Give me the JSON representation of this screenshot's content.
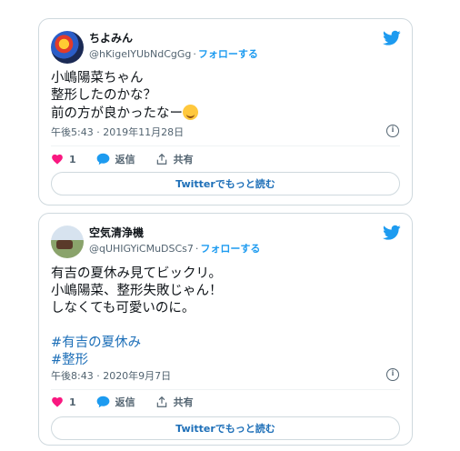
{
  "tweets": [
    {
      "name": "ちよみん",
      "handle": "@hKigeIYUbNdCgGg",
      "follow": "フォローする",
      "lines": [
        "小嶋陽菜ちゃん",
        "整形したのかな？",
        "前の方が良かったなー"
      ],
      "emoji": "relieved-face-emoji",
      "date": "午後5:43 · 2019年11月28日",
      "likes": "1",
      "reply_label": "返信",
      "share_label": "共有",
      "more_label": "Twitterでもっと読む"
    },
    {
      "name": "空気清浄機",
      "handle": "@qUHIGYiCMuDSCs7",
      "follow": "フォローする",
      "lines": [
        "有吉の夏休み見てビックリ。",
        "小嶋陽菜、整形失敗じゃん！",
        "しなくても可愛いのに。"
      ],
      "hashtags": [
        "#有吉の夏休み",
        "#整形"
      ],
      "date": "午後8:43 · 2020年9月7日",
      "likes": "1",
      "reply_label": "返信",
      "share_label": "共有",
      "more_label": "Twitterでもっと読む"
    }
  ],
  "colors": {
    "accent": "#1d9bf0",
    "link": "#1d6fb8",
    "like": "#f91880",
    "muted": "#536471",
    "border": "#cfd9de"
  },
  "icons": [
    "twitter-bird-icon",
    "heart-icon",
    "reply-bubble-icon",
    "share-icon",
    "info-icon"
  ]
}
